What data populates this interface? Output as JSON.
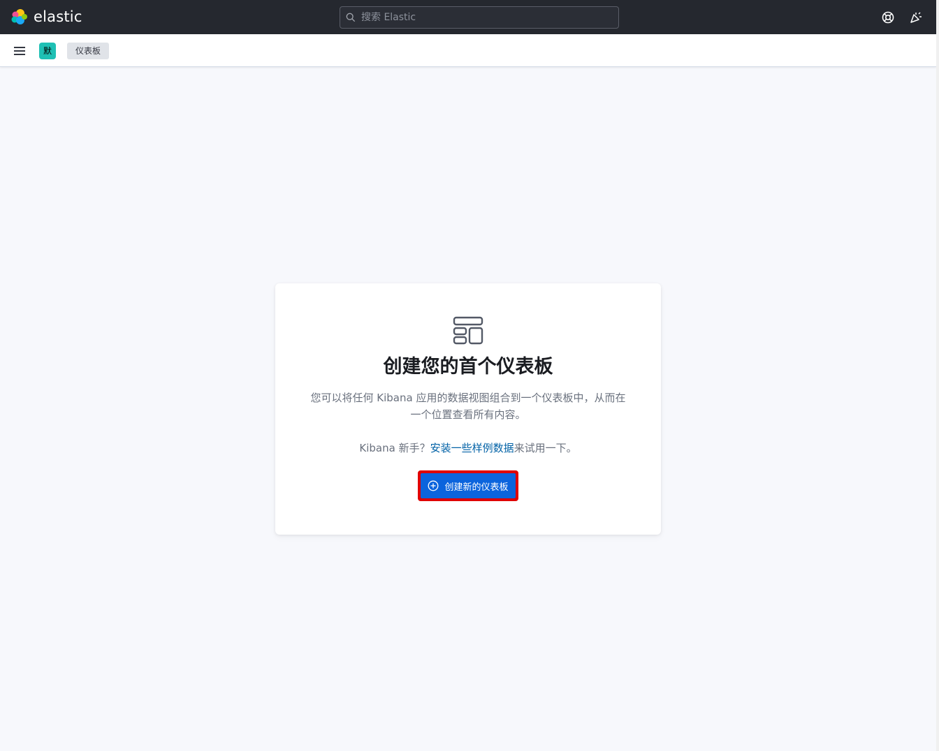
{
  "header": {
    "brand": "elastic",
    "search_placeholder": "搜索 Elastic",
    "colors": {
      "background": "#25282f",
      "search_bg": "#2b2e36"
    },
    "icons": [
      "help-icon",
      "news-feed-icon"
    ]
  },
  "subheader": {
    "space_initial": "默",
    "breadcrumb": "仪表板",
    "space_color": "#1fc0b4"
  },
  "empty_state": {
    "icon": "dashboard-layout-icon",
    "title": "创建您的首个仪表板",
    "description": "您可以将任何 Kibana 应用的数据视图组合到一个仪表板中，从而在一个位置查看所有内容。",
    "newbie_prefix": "Kibana 新手？",
    "sample_data_link": "安装一些样例数据",
    "newbie_suffix": "来试用一下。",
    "create_button": "创建新的仪表板",
    "accent_color": "#0b64dd",
    "link_color": "#0061a6"
  }
}
